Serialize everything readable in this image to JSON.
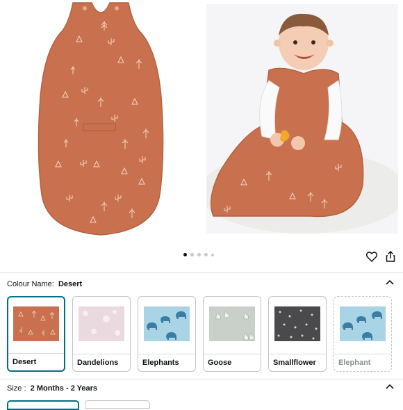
{
  "colors": {
    "accent": "#007185",
    "sack": "#c9714f",
    "sack_dark": "#b3613f"
  },
  "gallery": {
    "images": [
      {
        "icon": "sleep-sack-flat-image"
      },
      {
        "icon": "baby-in-sleep-sack-image"
      }
    ],
    "pagination": {
      "count": 5,
      "active_index": 0
    },
    "actions": {
      "favorite_icon": "heart-icon",
      "share_icon": "share-icon"
    }
  },
  "colour_section": {
    "label": "Colour Name:",
    "selected_value": "Desert",
    "swatches": [
      {
        "name": "Desert",
        "selected": true,
        "available": true,
        "pattern": "desert"
      },
      {
        "name": "Dandelions",
        "selected": false,
        "available": true,
        "pattern": "dandelions"
      },
      {
        "name": "Elephants",
        "selected": false,
        "available": true,
        "pattern": "elephants"
      },
      {
        "name": "Goose",
        "selected": false,
        "available": true,
        "pattern": "goose"
      },
      {
        "name": "Smallflower",
        "selected": false,
        "available": true,
        "pattern": "smallflower"
      },
      {
        "name": "Elephant",
        "selected": false,
        "available": false,
        "pattern": "elephants"
      }
    ]
  },
  "size_section": {
    "label": "Size :",
    "selected_value": "2 Months - 2 Years"
  }
}
